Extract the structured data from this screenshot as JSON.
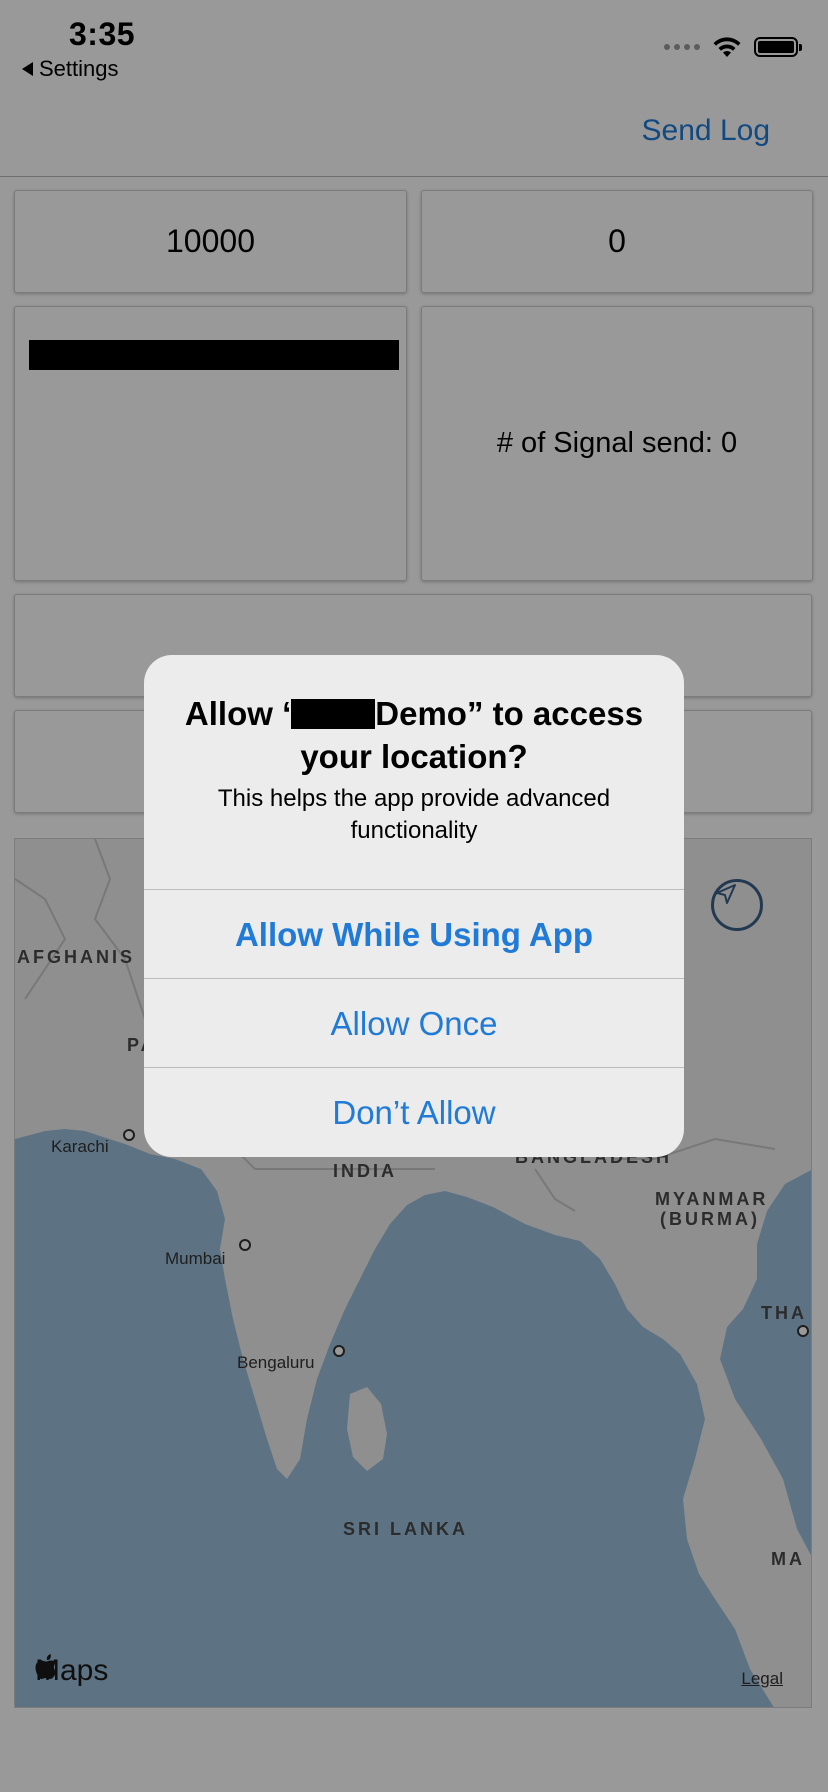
{
  "status_bar": {
    "time": "3:35",
    "back_label": "Settings"
  },
  "nav": {
    "send_log_label": "Send Log"
  },
  "panels": {
    "top_left_value": "10000",
    "top_right_value": "0",
    "signal_text": "# of Signal send: 0"
  },
  "map": {
    "labels": {
      "afghanistan": "AFGHANIS",
      "pakistan": "PA",
      "india": "INDIA",
      "bangladesh": "BANGLADESH",
      "myanmar_1": "MYANMAR",
      "myanmar_2": "(BURMA)",
      "thailand": "THA",
      "sri_lanka": "SRI LANKA",
      "malaysia": "MA"
    },
    "cities": {
      "karachi": "Karachi",
      "mumbai": "Mumbai",
      "bengaluru": "Bengaluru"
    },
    "maps_brand": "Maps",
    "legal": "Legal"
  },
  "alert": {
    "title_prefix": "Allow ‘",
    "title_suffix": "Demo” to access your location?",
    "message": "This helps the app provide advanced functionality",
    "buttons": {
      "allow_while_using": "Allow While Using App",
      "allow_once": "Allow Once",
      "dont_allow": "Don’t Allow"
    }
  },
  "colors": {
    "accent": "#1f7ad8",
    "map_water": "#9cc0dd",
    "map_land": "#efefef"
  }
}
